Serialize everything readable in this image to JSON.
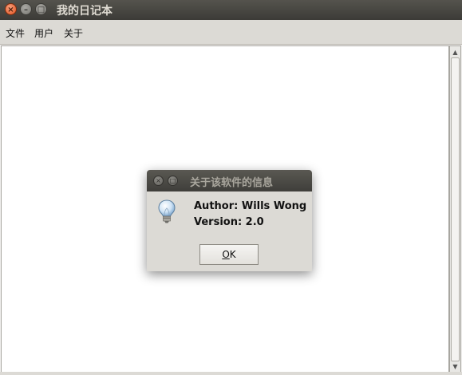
{
  "window": {
    "title": "我的日记本",
    "close_glyph": "×",
    "minimize_glyph": "–",
    "maximize_glyph": "□"
  },
  "menubar": {
    "items": [
      {
        "label": "文件"
      },
      {
        "label": "用户"
      },
      {
        "label": "关于"
      }
    ]
  },
  "scrollbar": {
    "up_glyph": "▲",
    "down_glyph": "▼"
  },
  "dialog": {
    "title": "关于该软件的信息",
    "close_glyph": "×",
    "maximize_glyph": "□",
    "icon": "lightbulb-icon",
    "lines": [
      "Author: Wills Wong",
      "Version: 2.0"
    ],
    "ok_mnemonic": "O",
    "ok_rest": "K"
  },
  "colors": {
    "titlebar": "#3c3b37",
    "close_button": "#e2531f",
    "menubar": "#dcdad5",
    "content_bg": "#ffffff"
  }
}
